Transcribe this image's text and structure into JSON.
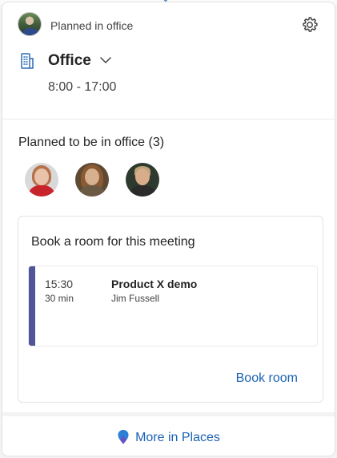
{
  "header": {
    "status": "Planned in office",
    "avatar_icon": "user-avatar",
    "settings_icon": "gear-icon"
  },
  "location": {
    "icon": "building-icon",
    "name": "Office",
    "hours": "8:00 - 17:00"
  },
  "planned": {
    "heading": "Planned to be in office (3)",
    "people": [
      {
        "name": "person-1"
      },
      {
        "name": "person-2"
      },
      {
        "name": "person-3"
      }
    ]
  },
  "booking": {
    "heading": "Book a room for this meeting",
    "meeting": {
      "time": "15:30",
      "duration": "30 min",
      "title": "Product X demo",
      "organizer": "Jim Fussell",
      "accent_color": "#4f5599"
    },
    "book_button": "Book room"
  },
  "footer": {
    "link": "More in Places",
    "icon": "places-icon"
  },
  "colors": {
    "link": "#1a62b3",
    "text": "#242424"
  }
}
